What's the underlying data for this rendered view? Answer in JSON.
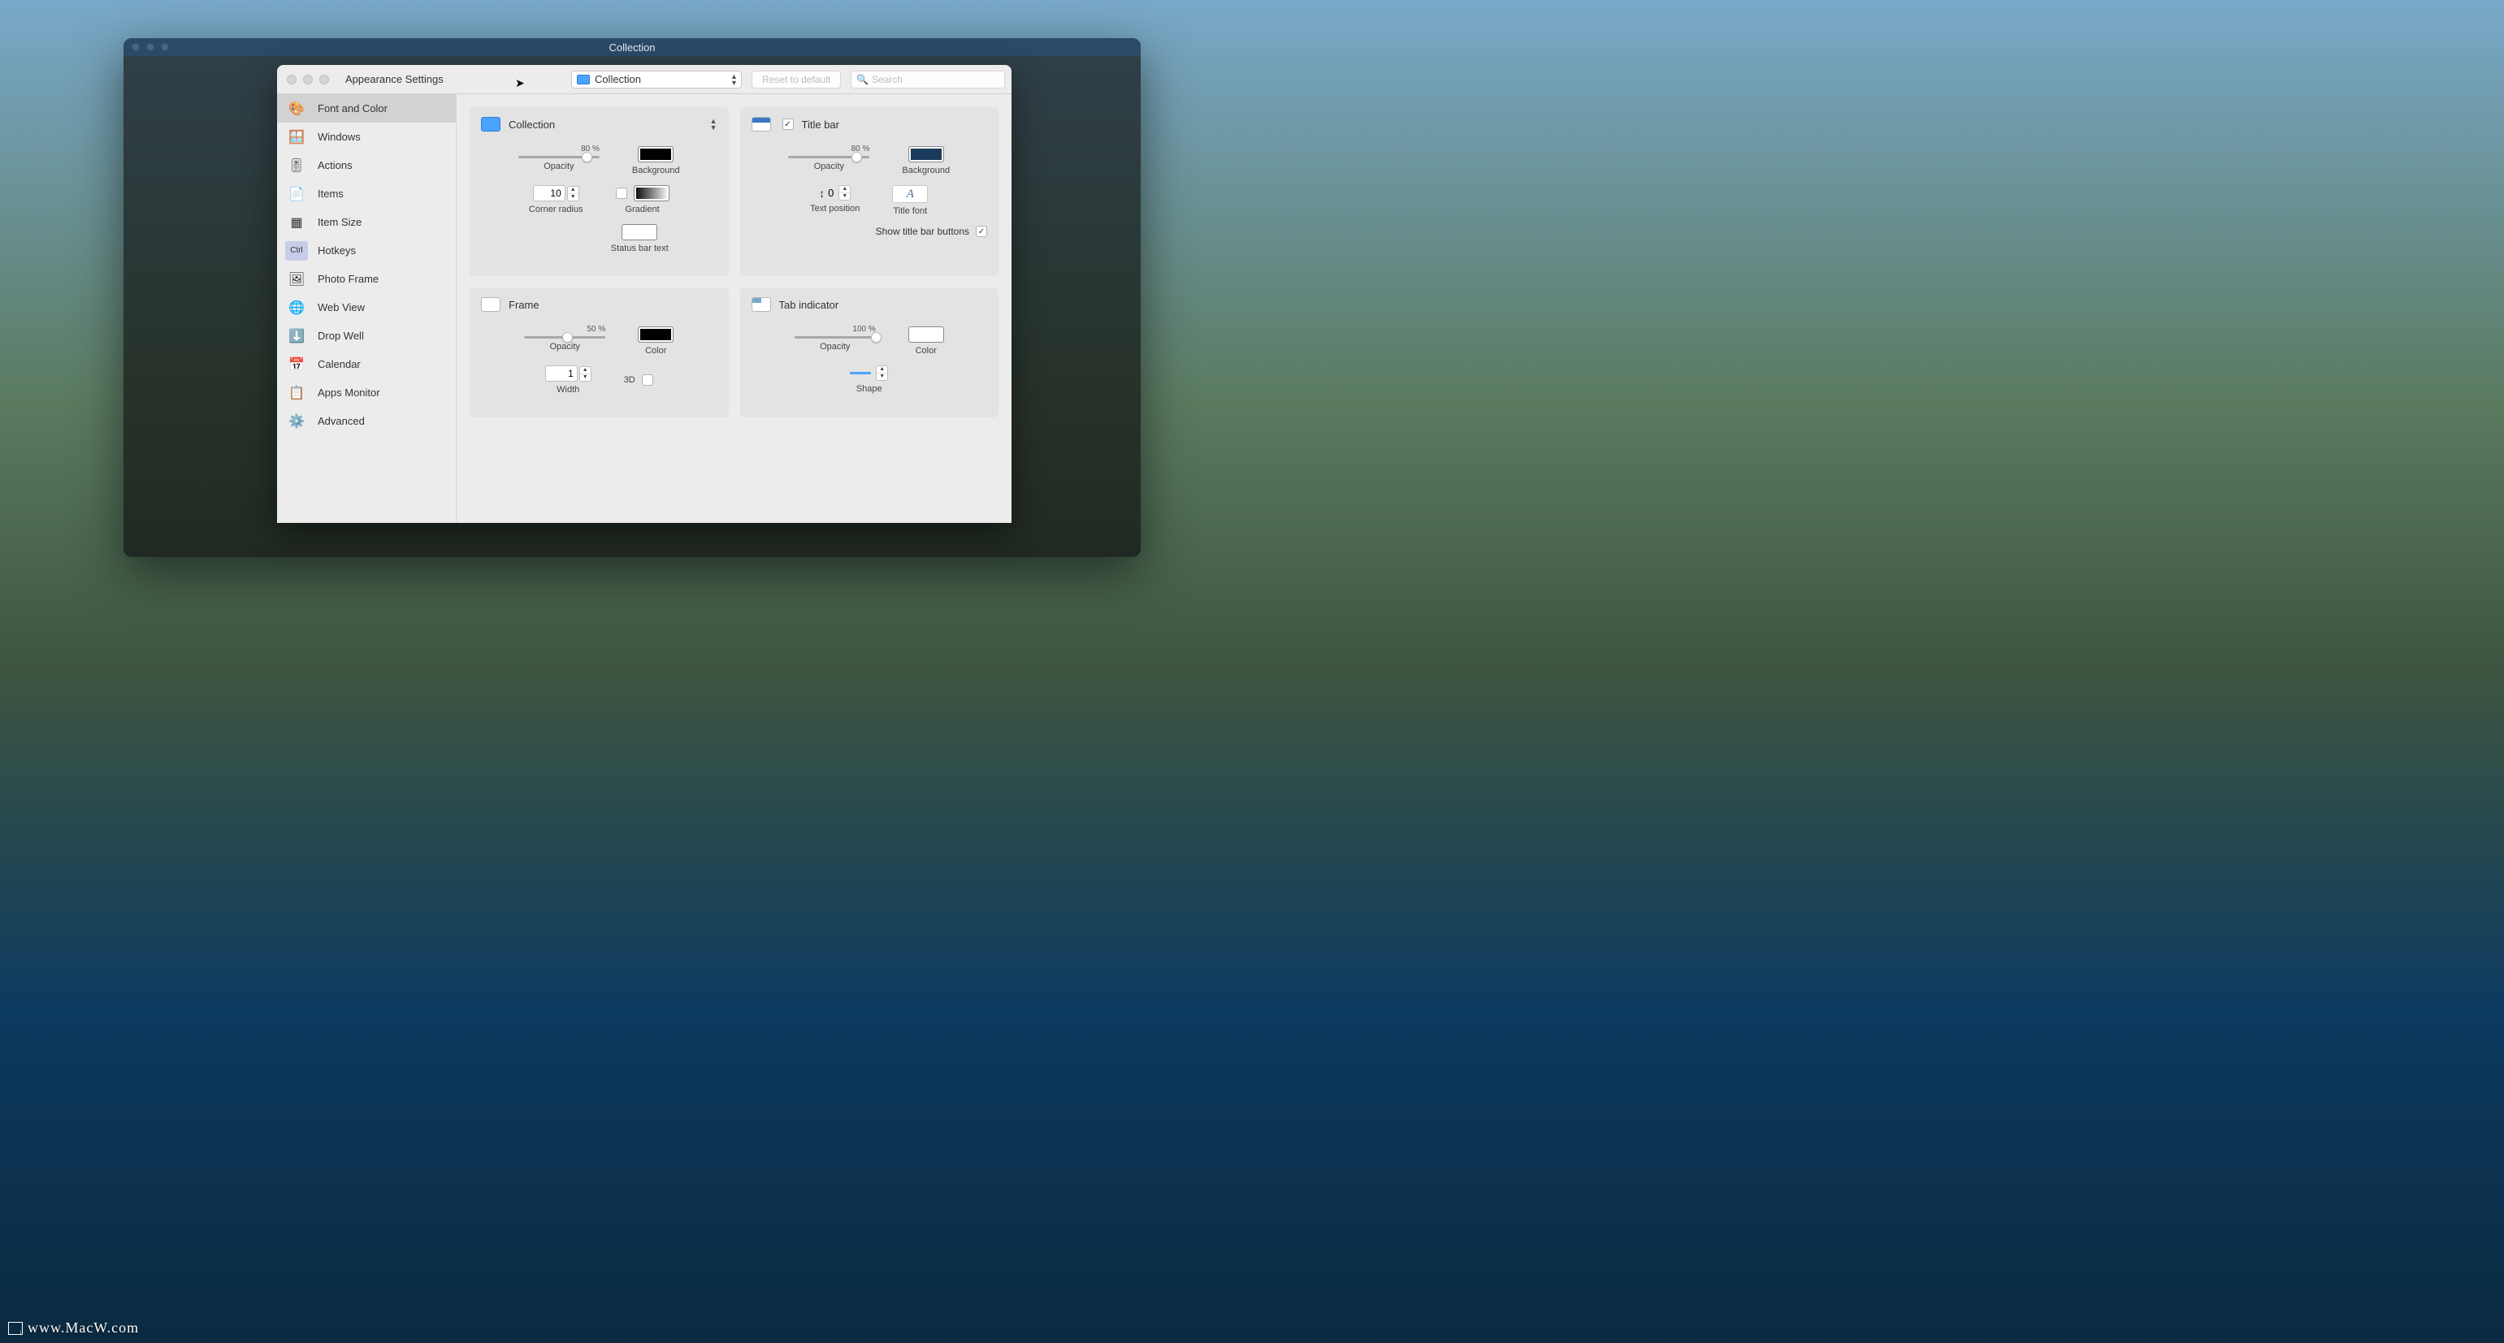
{
  "outer_window": {
    "title": "Collection"
  },
  "toolbar": {
    "title": "Appearance Settings",
    "dropdown_value": "Collection",
    "reset_label": "Reset to default",
    "search_placeholder": "Search"
  },
  "sidebar": {
    "items": [
      {
        "id": "font-color",
        "label": "Font and Color",
        "icon": "🎨",
        "selected": true
      },
      {
        "id": "windows",
        "label": "Windows",
        "icon": "🪟"
      },
      {
        "id": "actions",
        "label": "Actions",
        "icon": "🎚"
      },
      {
        "id": "items",
        "label": "Items",
        "icon": "📄"
      },
      {
        "id": "item-size",
        "label": "Item Size",
        "icon": "▦"
      },
      {
        "id": "hotkeys",
        "label": "Hotkeys",
        "icon": "⌨"
      },
      {
        "id": "photo-frame",
        "label": "Photo Frame",
        "icon": "🖼"
      },
      {
        "id": "web-view",
        "label": "Web View",
        "icon": "🌐"
      },
      {
        "id": "drop-well",
        "label": "Drop Well",
        "icon": "⬇"
      },
      {
        "id": "calendar",
        "label": "Calendar",
        "icon": "📅"
      },
      {
        "id": "apps-monitor",
        "label": "Apps Monitor",
        "icon": "📋"
      },
      {
        "id": "advanced",
        "label": "Advanced",
        "icon": "⚙"
      }
    ]
  },
  "panels": {
    "collection": {
      "title": "Collection",
      "opacity_pct": "80 %",
      "opacity_label": "Opacity",
      "background_label": "Background",
      "corner_radius_value": "10",
      "corner_radius_label": "Corner radius",
      "gradient_label": "Gradient",
      "statusbar_label": "Status bar text"
    },
    "titlebar": {
      "title": "Title bar",
      "enabled": true,
      "opacity_pct": "80 %",
      "opacity_label": "Opacity",
      "background_label": "Background",
      "text_position_value": "0",
      "text_position_label": "Text position",
      "title_font_label": "Title font",
      "show_buttons_label": "Show title bar buttons",
      "show_buttons_checked": true
    },
    "frame": {
      "title": "Frame",
      "opacity_pct": "50 %",
      "opacity_label": "Opacity",
      "color_label": "Color",
      "width_value": "1",
      "width_label": "Width",
      "threeD_label": "3D"
    },
    "tab": {
      "title": "Tab indicator",
      "opacity_pct": "100 %",
      "opacity_label": "Opacity",
      "color_label": "Color",
      "shape_label": "Shape"
    }
  },
  "watermark": "www.MacW.com",
  "colors": {
    "accent": "#4aa3ff",
    "panel_bg": "#e3e3e3",
    "sidebar_selected": "#d2d2d2"
  }
}
